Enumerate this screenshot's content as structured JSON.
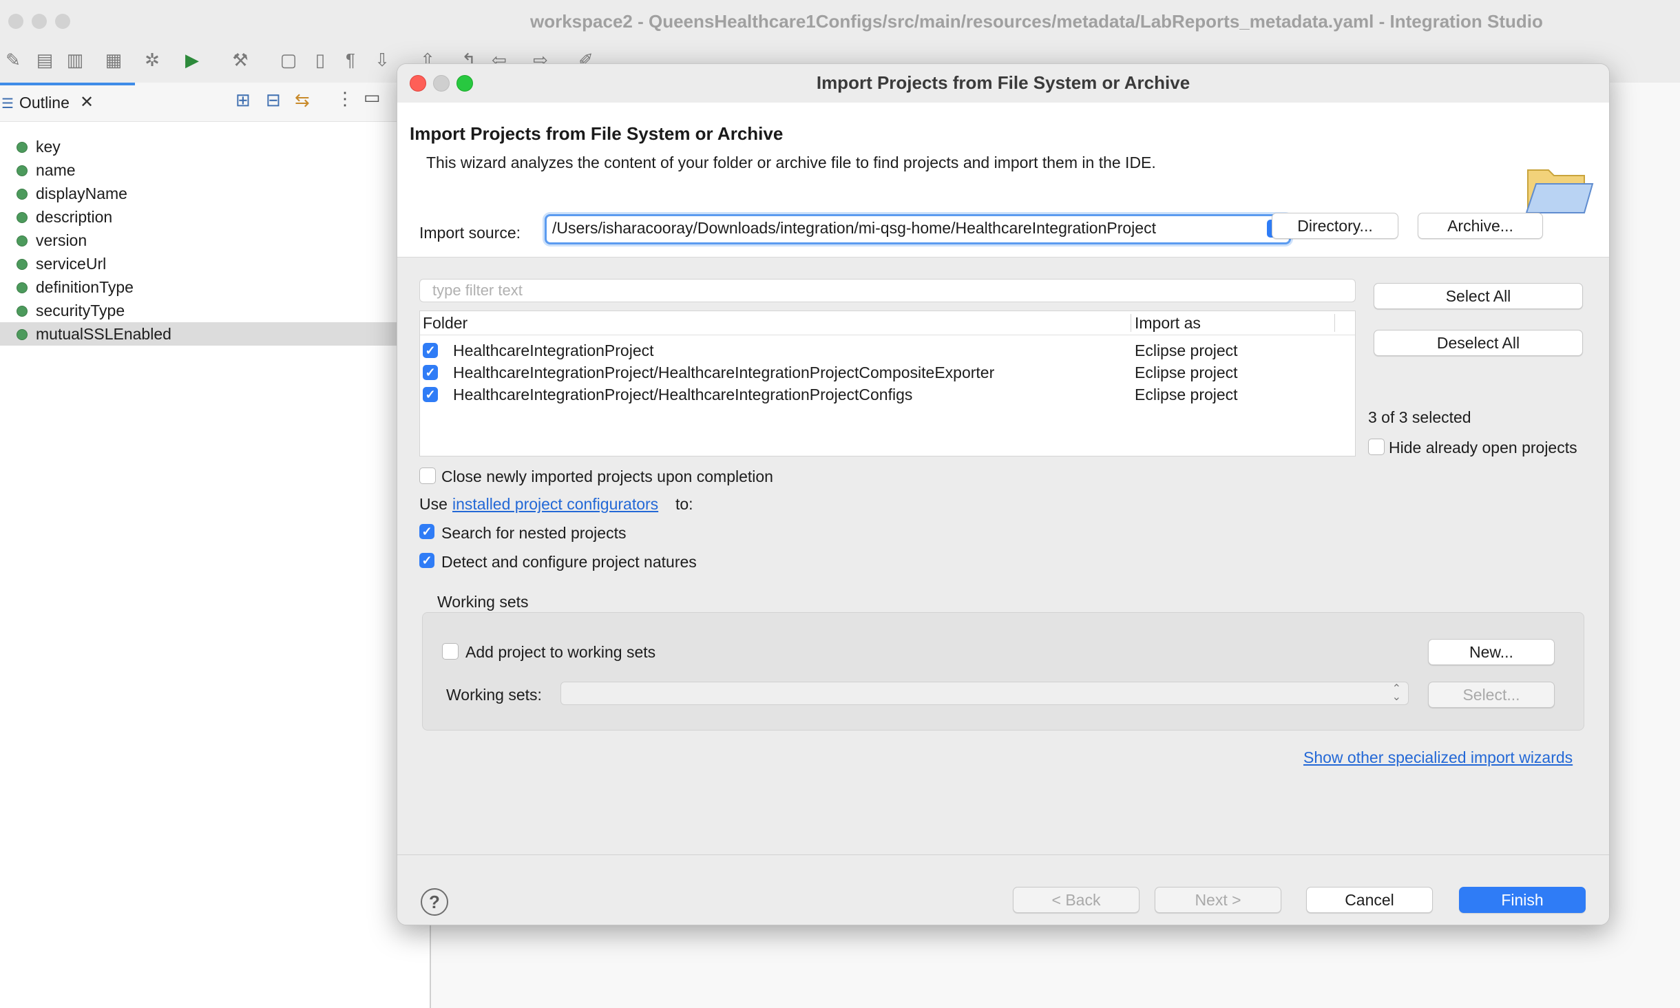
{
  "window": {
    "title": "workspace2 - QueensHealthcare1Configs/src/main/resources/metadata/LabReports_metadata.yaml - Integration Studio"
  },
  "outline": {
    "tab_label": "Outline",
    "items": [
      {
        "label": "key"
      },
      {
        "label": "name"
      },
      {
        "label": "displayName"
      },
      {
        "label": "description"
      },
      {
        "label": "version"
      },
      {
        "label": "serviceUrl"
      },
      {
        "label": "definitionType"
      },
      {
        "label": "securityType"
      },
      {
        "label": "mutualSSLEnabled"
      }
    ]
  },
  "dialog": {
    "window_title": "Import Projects from File System or Archive",
    "heading": "Import Projects from File System or Archive",
    "description": "This wizard analyzes the content of your folder or archive file to find projects and import them in the IDE.",
    "import_source_label": "Import source:",
    "import_source_value": "/Users/isharacooray/Downloads/integration/mi-qsg-home/HealthcareIntegrationProject",
    "directory_button": "Directory...",
    "archive_button": "Archive...",
    "filter_placeholder": "type filter text",
    "select_all_button": "Select All",
    "deselect_all_button": "Deselect All",
    "table": {
      "col_folder": "Folder",
      "col_import_as": "Import as",
      "rows": [
        {
          "folder": "HealthcareIntegrationProject",
          "import_as": "Eclipse project",
          "checked": true
        },
        {
          "folder": "HealthcareIntegrationProject/HealthcareIntegrationProjectCompositeExporter",
          "import_as": "Eclipse project",
          "checked": true
        },
        {
          "folder": "HealthcareIntegrationProject/HealthcareIntegrationProjectConfigs",
          "import_as": "Eclipse project",
          "checked": true
        }
      ]
    },
    "selected_count": "3 of 3 selected",
    "hide_open_label": "Hide already open projects",
    "close_imported_label": "Close newly imported projects upon completion",
    "use_prefix": "Use",
    "configurators_link": "installed project configurators",
    "use_suffix": "to:",
    "search_nested_label": "Search for nested projects",
    "detect_natures_label": "Detect and configure project natures",
    "working_sets_group": "Working sets",
    "add_to_ws_label": "Add project to working sets",
    "new_button": "New...",
    "working_sets_label": "Working sets:",
    "select_button": "Select...",
    "other_wizards_link": "Show other specialized import wizards",
    "back_button": "< Back",
    "next_button": "Next >",
    "cancel_button": "Cancel",
    "finish_button": "Finish"
  },
  "colors": {
    "accent": "#2f7cf6",
    "link": "#2368d6",
    "outline_dot": "#4c9a5c"
  }
}
